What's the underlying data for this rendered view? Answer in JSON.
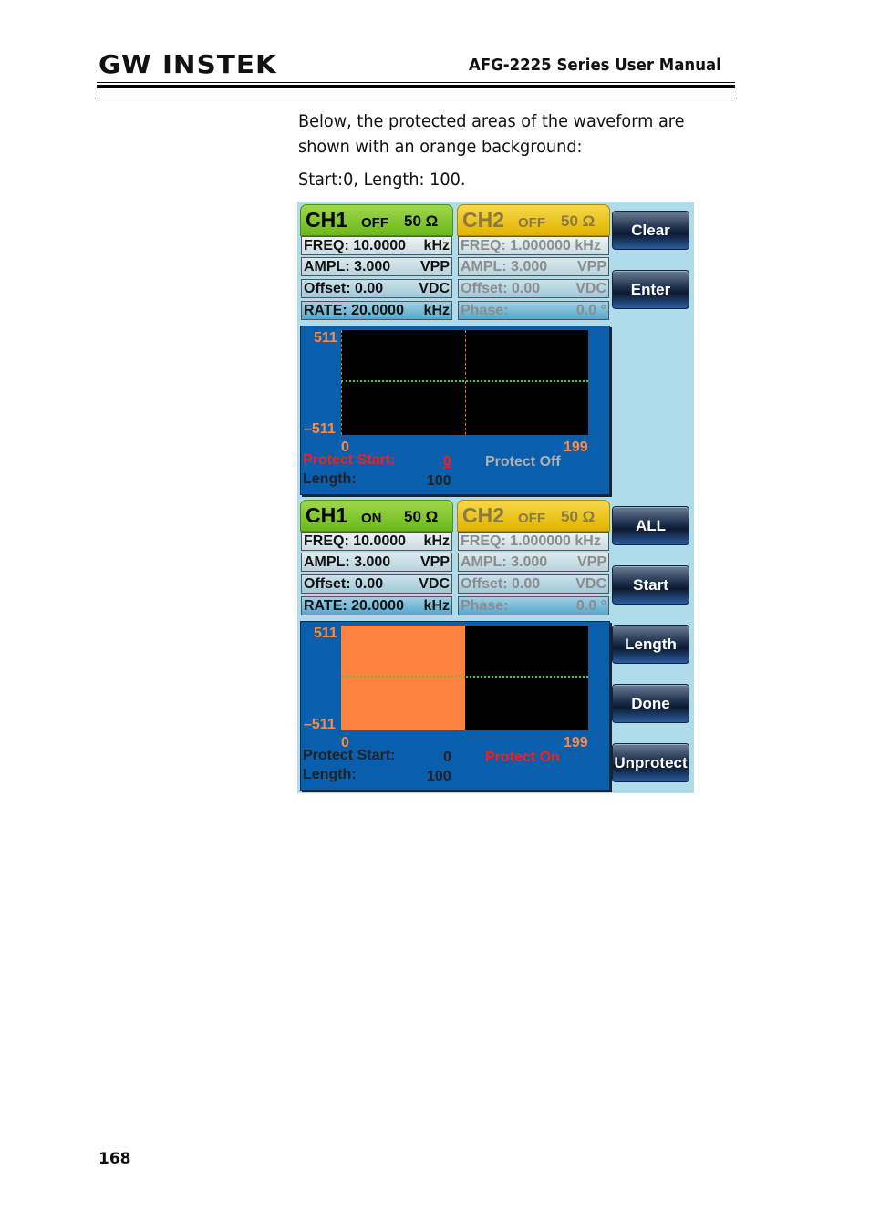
{
  "header": {
    "logo": "GW INSTEK",
    "title": "AFG-2225 Series User Manual"
  },
  "body": {
    "paragraph_line1": "Below, the protected areas of the waveform are",
    "paragraph_line2": "shown with an orange background:",
    "caption": "Start:0, Length: 100."
  },
  "screens": [
    {
      "ch1": {
        "name": "CH1",
        "state": "OFF",
        "impedance": "50 Ω",
        "params": [
          {
            "label": "FREQ: 10.0000",
            "unit": "kHz"
          },
          {
            "label": "AMPL:  3.000",
            "unit": "VPP"
          },
          {
            "label": "Offset:   0.00",
            "unit": "VDC"
          },
          {
            "label": "RATE: 20.0000",
            "unit": "kHz"
          }
        ]
      },
      "ch2": {
        "name": "CH2",
        "state": "OFF",
        "impedance": "50 Ω",
        "params": [
          {
            "label": "FREQ: 1.000000 kHz",
            "unit": ""
          },
          {
            "label": "AMPL:  3.000",
            "unit": "VPP"
          },
          {
            "label": "Offset:   0.00",
            "unit": "VDC"
          },
          {
            "label": "Phase:",
            "unit": "0.0 °"
          }
        ]
      },
      "graph": {
        "y_max": "511",
        "y_min": "–511",
        "x_min": "0",
        "x_max": "199",
        "protect_start_label": "Protect Start:",
        "protect_start_value": "0",
        "length_label": "Length:",
        "length_value": "100",
        "protect_status": "Protect Off",
        "protected": false,
        "protect_fraction": 0.5
      },
      "buttons": [
        "Clear",
        "Enter"
      ]
    },
    {
      "ch1": {
        "name": "CH1",
        "state": "ON",
        "impedance": "50 Ω",
        "params": [
          {
            "label": "FREQ: 10.0000",
            "unit": "kHz"
          },
          {
            "label": "AMPL:  3.000",
            "unit": "VPP"
          },
          {
            "label": "Offset:   0.00",
            "unit": "VDC"
          },
          {
            "label": "RATE: 20.0000",
            "unit": "kHz"
          }
        ]
      },
      "ch2": {
        "name": "CH2",
        "state": "OFF",
        "impedance": "50 Ω",
        "params": [
          {
            "label": "FREQ: 1.000000 kHz",
            "unit": ""
          },
          {
            "label": "AMPL:  3.000",
            "unit": "VPP"
          },
          {
            "label": "Offset:   0.00",
            "unit": "VDC"
          },
          {
            "label": "Phase:",
            "unit": "0.0 °"
          }
        ]
      },
      "graph": {
        "y_max": "511",
        "y_min": "–511",
        "x_min": "0",
        "x_max": "199",
        "protect_start_label": "Protect Start:",
        "protect_start_value": "0",
        "length_label": "Length:",
        "length_value": "100",
        "protect_status": "Protect On",
        "protected": true,
        "protect_fraction": 0.5
      },
      "buttons": [
        "ALL",
        "Start",
        "Length",
        "Done",
        "Unprotect"
      ]
    }
  ],
  "colors": {
    "protected_area": "#ff8340",
    "waveform": "#3fd43f",
    "active_red": "#ff1a1a",
    "inactive_gray": "#b0b0b0"
  },
  "footer": {
    "page_number": "168"
  }
}
